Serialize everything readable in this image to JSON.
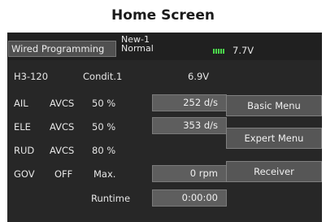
{
  "page_heading": "Home Screen",
  "topbar": {
    "programming_tab": "Wired Programming",
    "model_name": "New-1",
    "condition_mode": "Normal",
    "battery_icon": "battery-level-icon",
    "battery_voltage": "7.7V"
  },
  "summary": {
    "model_type": "H3-120",
    "condition": "Condit.1",
    "receiver_voltage": "6.9V"
  },
  "gyro_rows": [
    {
      "channel": "AIL",
      "mode": "AVCS",
      "gain": "50 %",
      "rate": "252 d/s"
    },
    {
      "channel": "ELE",
      "mode": "AVCS",
      "gain": "50 %",
      "rate": "353 d/s"
    },
    {
      "channel": "RUD",
      "mode": "AVCS",
      "gain": "80 %"
    }
  ],
  "governor": {
    "label": "GOV",
    "status": "OFF",
    "max_label": "Max.",
    "rpm": "0 rpm"
  },
  "runtime": {
    "label": "Runtime",
    "value": "0:00:00"
  },
  "menu_buttons": {
    "basic": "Basic Menu",
    "expert": "Expert Menu",
    "receiver": "Receiver"
  },
  "colors": {
    "screen_background": "#272727",
    "button_background": "#565656",
    "battery_indicator": "#4cd84c"
  }
}
